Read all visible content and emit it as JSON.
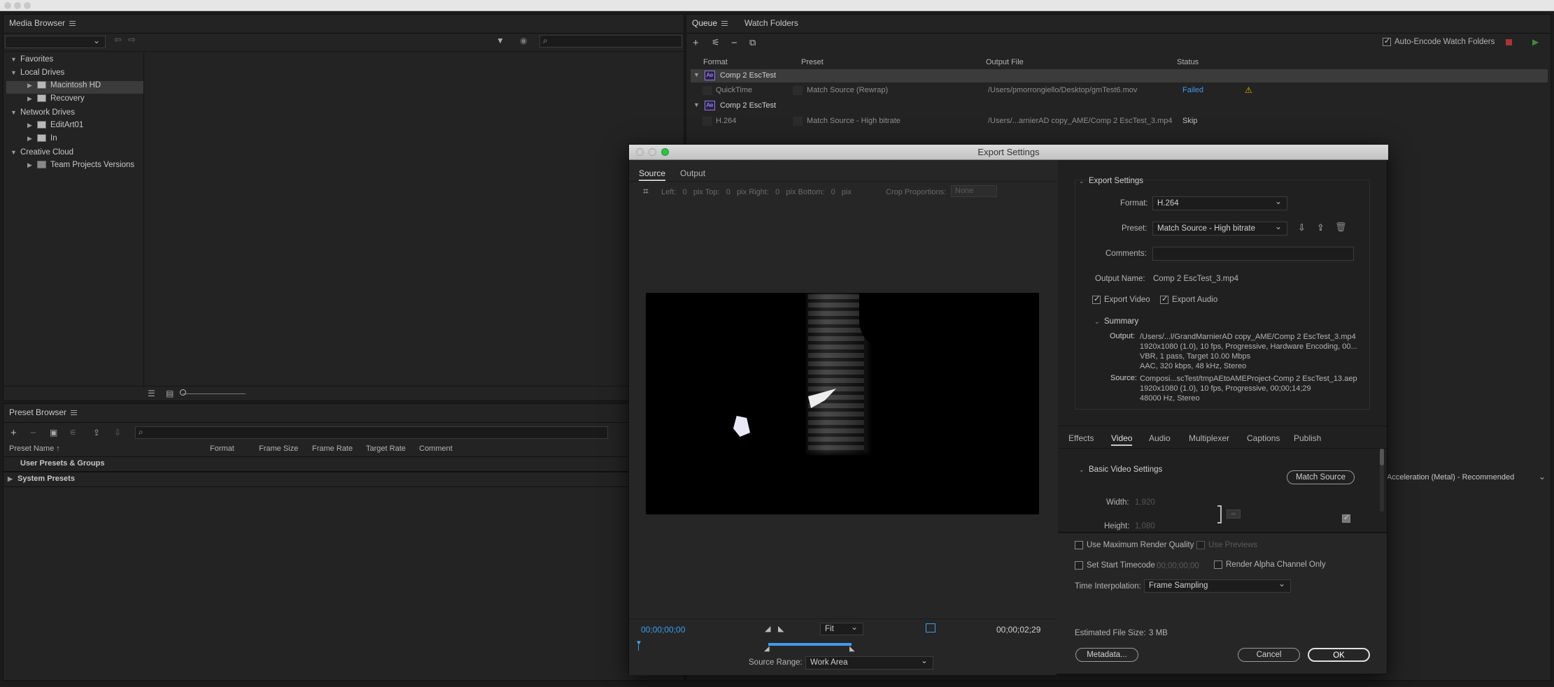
{
  "media_browser": {
    "title": "Media Browser",
    "tree": [
      {
        "label": "Favorites"
      },
      {
        "label": "Local Drives"
      },
      {
        "label": "Macintosh HD"
      },
      {
        "label": "Recovery"
      },
      {
        "label": "Network Drives"
      },
      {
        "label": "EditArt01"
      },
      {
        "label": "In"
      },
      {
        "label": "Creative Cloud"
      },
      {
        "label": "Team Projects Versions"
      }
    ]
  },
  "queue": {
    "tabs": [
      "Queue",
      "Watch Folders"
    ],
    "auto_encode_label": "Auto-Encode Watch Folders",
    "headers": {
      "format": "Format",
      "preset": "Preset",
      "output": "Output File",
      "status": "Status"
    },
    "items": [
      {
        "comp": "Comp 2 EscTest",
        "format": "QuickTime",
        "preset": "Match Source (Rewrap)",
        "output": "/Users/pmorrongiello/Desktop/gmTest6.mov",
        "status": "Failed"
      },
      {
        "comp": "Comp 2 EscTest",
        "format": "H.264",
        "preset": "Match Source - High bitrate",
        "output": "/Users/...arnierAD copy_AME/Comp 2 EscTest_3.mp4",
        "status": "Skip"
      }
    ],
    "renderer": "Acceleration (Metal) - Recommended"
  },
  "preset_browser": {
    "title": "Preset Browser",
    "headers": {
      "name": "Preset Name",
      "format": "Format",
      "frame_size": "Frame Size",
      "frame_rate": "Frame Rate",
      "target_rate": "Target Rate",
      "comment": "Comment"
    },
    "groups": [
      "User Presets & Groups",
      "System Presets"
    ]
  },
  "export": {
    "title": "Export Settings",
    "left_tabs": [
      "Source",
      "Output"
    ],
    "crop": {
      "left_label": "Left:",
      "left_val": "0",
      "top_label": "Top:",
      "top_val": "0",
      "right_label": "Right:",
      "right_val": "0",
      "bottom_label": "Bottom:",
      "bottom_val": "0",
      "unit": "pix",
      "proportions_label": "Crop Proportions:",
      "proportions_val": "None"
    },
    "timecode_start": "00;00;00;00",
    "timecode_end": "00;00;02;29",
    "fit": "Fit",
    "source_range_label": "Source Range:",
    "source_range_val": "Work Area",
    "settings_header": "Export Settings",
    "format_label": "Format:",
    "format_val": "H.264",
    "preset_label": "Preset:",
    "preset_val": "Match Source - High bitrate",
    "comments_label": "Comments:",
    "output_name_label": "Output Name:",
    "output_name_val": "Comp 2 EscTest_3.mp4",
    "export_video": "Export Video",
    "export_audio": "Export Audio",
    "summary_header": "Summary",
    "output_key": "Output:",
    "output_lines": [
      "/Users/...l/GrandMarnierAD copy_AME/Comp 2 EscTest_3.mp4",
      "1920x1080 (1.0), 10 fps, Progressive, Hardware Encoding, 00...",
      "VBR, 1 pass, Target 10.00 Mbps",
      "AAC, 320 kbps, 48 kHz, Stereo"
    ],
    "source_key": "Source:",
    "source_lines": [
      "Composi...scTest/tmpAEtoAMEProject-Comp 2 EscTest_13.aep",
      "1920x1080 (1.0), 10 fps, Progressive, 00;00;14;29",
      "48000 Hz, Stereo"
    ],
    "right_tabs": [
      "Effects",
      "Video",
      "Audio",
      "Multiplexer",
      "Captions",
      "Publish"
    ],
    "basic_video": "Basic Video Settings",
    "match_source": "Match Source",
    "width_label": "Width:",
    "width_val": "1,920",
    "height_label": "Height:",
    "height_val": "1,080",
    "max_render": "Use Maximum Render Quality",
    "use_previews": "Use Previews",
    "set_start_tc": "Set Start Timecode",
    "start_tc_val": "00;00;00;00",
    "alpha_only": "Render Alpha Channel Only",
    "time_interp_label": "Time Interpolation:",
    "time_interp_val": "Frame Sampling",
    "est_size_label": "Estimated File Size:",
    "est_size_val": "3 MB",
    "metadata_btn": "Metadata...",
    "cancel_btn": "Cancel",
    "ok_btn": "OK"
  }
}
